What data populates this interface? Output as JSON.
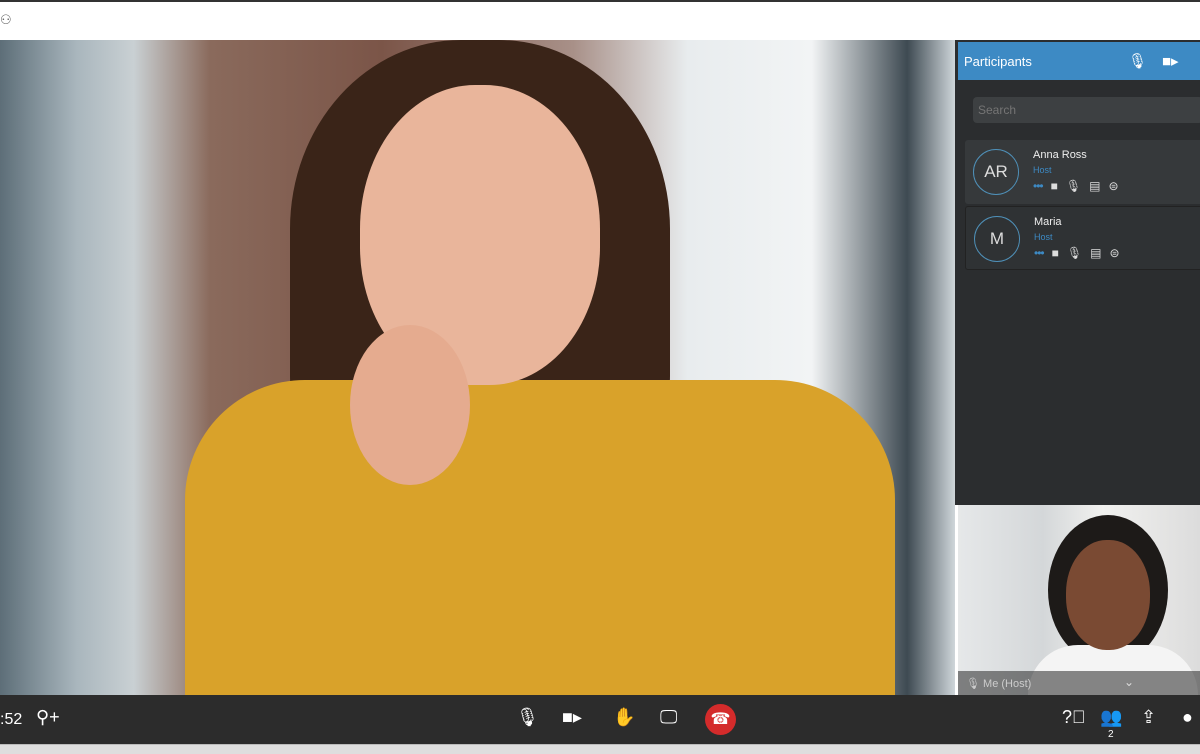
{
  "window": {
    "app_icon": "meeting-app-icon"
  },
  "participants_panel": {
    "title": "Participants",
    "header_icons": [
      "mic-icon",
      "video-icon"
    ],
    "search_placeholder": "Search",
    "participants": [
      {
        "initials": "AR",
        "name": "Anna Ross",
        "role": "Host"
      },
      {
        "initials": "M",
        "name": "Maria",
        "role": "Host"
      }
    ]
  },
  "self_view": {
    "label": "Me (Host)"
  },
  "toolbar": {
    "elapsed_time": ":52",
    "participant_count": "2",
    "hangup_color": "#d42b2b",
    "accent_color": "#3d8ac4"
  }
}
